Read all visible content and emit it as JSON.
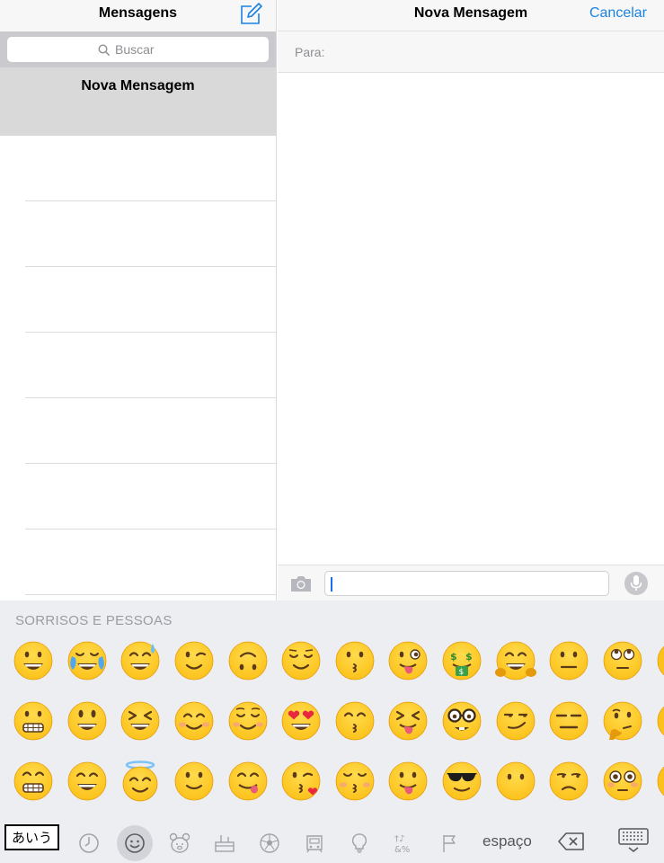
{
  "left": {
    "title": "Mensagens",
    "search_placeholder": "Buscar",
    "selected_conversation": "Nova Mensagem"
  },
  "right": {
    "title": "Nova Mensagem",
    "cancel_label": "Cancelar",
    "to_label": "Para:"
  },
  "keyboard": {
    "section_title": "SORRISOS E PESSOAS",
    "kana_label": "あいう",
    "space_label": "espaço",
    "categories": [
      "recent-icon",
      "smileys-icon",
      "animals-icon",
      "food-icon",
      "sports-icon",
      "travel-icon",
      "objects-icon",
      "symbols-icon",
      "flags-icon"
    ],
    "emoji_rows": [
      [
        "grinning",
        "tears-of-joy",
        "sweat-smile",
        "wink",
        "upside-down",
        "relieved",
        "kissing",
        "stuck-out-tongue-winking",
        "money-mouth",
        "hugging",
        "neutral",
        "rolling-eyes"
      ],
      [
        "grimacing",
        "smiley",
        "laughing",
        "blush",
        "relaxed",
        "heart-eyes",
        "kissing-smiling-eyes",
        "stuck-out-tongue-closed-eyes",
        "nerd",
        "smirk",
        "expressionless",
        "thinking"
      ],
      [
        "grin",
        "smile",
        "innocent",
        "slightly-smiling",
        "yum",
        "kissing-heart",
        "kissing-closed-eyes",
        "stuck-out-tongue",
        "sunglasses",
        "no-mouth",
        "unamused",
        "flushed"
      ]
    ]
  },
  "colors": {
    "accent": "#1a82e2",
    "emoji_face": "#fcc21b",
    "emoji_face_dark": "#e49a0b",
    "keyboard_bg": "#eceef1"
  }
}
